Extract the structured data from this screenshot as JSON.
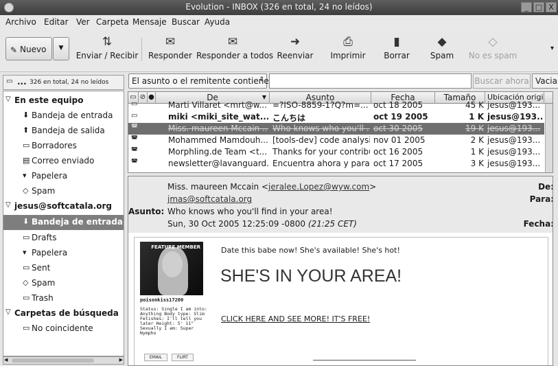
{
  "window": {
    "title": "Evolution - INBOX (326 en total, 24 no leídos)",
    "minimize": "_",
    "maximize": "□",
    "close": "X"
  },
  "menu": [
    "Archivo",
    "Editar",
    "Ver",
    "Carpeta",
    "Mensaje",
    "Buscar",
    "Ayuda"
  ],
  "toolbar": {
    "new_label": "Nuevo",
    "send_receive": "Enviar / Recibir",
    "reply": "Responder",
    "reply_all": "Responder a todos",
    "forward": "Reenviar",
    "print": "Imprimir",
    "delete": "Borrar",
    "spam": "Spam",
    "not_spam": "No es spam"
  },
  "sidebar": {
    "header_dots": "...",
    "header_count": "326 en total, 24 no leídos",
    "items": [
      {
        "label": "En este equipo"
      },
      {
        "label": "Bandeja de entrada"
      },
      {
        "label": "Bandeja de salida"
      },
      {
        "label": "Borradores"
      },
      {
        "label": "Correo enviado"
      },
      {
        "label": "Papelera"
      },
      {
        "label": "Spam"
      },
      {
        "label": "jesus@softcatala.org"
      },
      {
        "label": "Bandeja de entrada ("
      },
      {
        "label": "Drafts"
      },
      {
        "label": "Papelera"
      },
      {
        "label": "Sent"
      },
      {
        "label": "Spam"
      },
      {
        "label": "Trash"
      },
      {
        "label": "Carpetas de búsqueda"
      },
      {
        "label": "No coincidente"
      }
    ]
  },
  "search": {
    "filter": "El asunto o el remitente contiene",
    "value": "",
    "search_now": "Buscar ahora",
    "clear": "Vaciar"
  },
  "columns": {
    "from": "De",
    "subject": "Asunto",
    "date": "Fecha",
    "size": "Tamaño",
    "location": "Ubicación origi"
  },
  "messages": [
    {
      "from": "Marti Villaret <mrt@w...",
      "subject": "=?ISO-8859-1?Q?m=...",
      "date": "oct 18 2005",
      "size": "45 K",
      "location": "jesus@193..."
    },
    {
      "from": "miki <miki_site_wat...",
      "subject": "こんちは",
      "date": "oct 19 2005",
      "size": "1 K",
      "location": "jesus@193..."
    },
    {
      "from": "Miss. maureen Mccain ...",
      "subject": "Who knows who you'll ...",
      "date": "oct 30 2005",
      "size": "19 K",
      "location": "jesus@193..."
    },
    {
      "from": "Mohammed Mamdouh...",
      "subject": "[tools-dev] code analysis...",
      "date": "nov 01 2005",
      "size": "2 K",
      "location": "jesus@193..."
    },
    {
      "from": "Morphling.de Team <t...",
      "subject": "Thanks for your contribu...",
      "date": "oct 16 2005",
      "size": "1 K",
      "location": "jesus@193..."
    },
    {
      "from": "newsletter@lavanguard...",
      "subject": "Encuentra ahora y para...",
      "date": "oct 17 2005",
      "size": "3 K",
      "location": "jesus@193..."
    }
  ],
  "preview": {
    "labels": {
      "from": "De:",
      "to": "Para:",
      "subject": "Asunto:",
      "date": "Fecha:"
    },
    "from_name": "Miss. maureen Mccain <",
    "from_email": "jeralee.Lopez@wyw.com",
    "from_close": ">",
    "to": "jmas@softcatala.org",
    "subject": "Who knows who you'll find in your area!",
    "date": "Sun, 30 Oct 2005 12:25:09 -0800",
    "date_local": "(21:25 CET)"
  },
  "ad": {
    "badge": "FEATURE MEMBER",
    "username": "poisonkiss17200",
    "details": "Status: Single I am into: Anything Body type: Slim Fetishes: I'll tell you later Height: 5' 11\" Sexually I am: Super Nympho",
    "btn_email": "EMAIL",
    "btn_flirt": "FLIRT",
    "tagline": "Date this babe now! She's available! She's hot!",
    "headline": "SHE'S IN YOUR AREA!",
    "link": "CLICK HERE AND SEE MORE! IT'S FREE!"
  }
}
